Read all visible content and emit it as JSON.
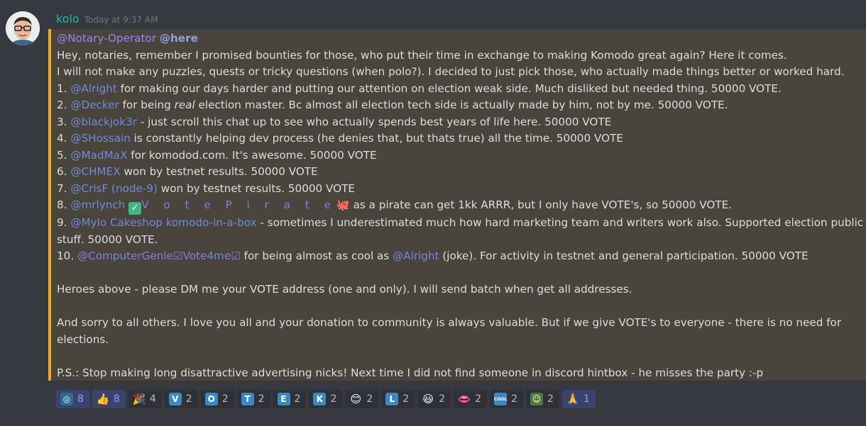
{
  "author": {
    "name": "kolo",
    "timestamp": "Today at 9:37 AM"
  },
  "message": {
    "mention_role": "@Notary-Operator",
    "mention_here": "@here",
    "line2": "Hey, notaries, remember I promised bounties for those, who put their time in exchange to making Komodo great again? Here it comes.",
    "line3": "I will not make any puzzles, quests or tricky questions (when polo?). I decided to just pick those, who actually made things better or worked hard.",
    "items": [
      {
        "num": "1.",
        "user": "@Alright",
        "text": " for making our days harder and putting our attention on election weak side. Much disliked but needed thing. 50000 VOTE."
      },
      {
        "num": "2.",
        "user": "@Decker",
        "pre": " for being ",
        "em": "real",
        "text": " election master. Bc almost all election tech side is actually made by him, not by me. 50000 VOTE."
      },
      {
        "num": "3.",
        "user": "@blackjok3r",
        "text": " - just scroll this chat up to see who actually spends best years of life here. 50000 VOTE"
      },
      {
        "num": "4.",
        "user": "@SHossain",
        "text": " is constantly helping dev process (he denies that, but thats true) all the time. 50000 VOTE"
      },
      {
        "num": "5.",
        "user": "@MadMaX",
        "text": " for komodod.com. It's awesome. 50000 VOTE"
      },
      {
        "num": "6.",
        "user": "@CHMEX",
        "text": " won by testnet results. 50000 VOTE"
      },
      {
        "num": "7.",
        "user": "@CrisF (node-9)",
        "text": " won by testnet results. 50000 VOTE"
      }
    ],
    "item8": {
      "num": "8.",
      "user": "@mrlynch",
      "check": "✓",
      "pirate": "V o t e P i r a t e",
      "octo": "🐙",
      "text": " as a pirate can get 1kk ARRR, but I only have VOTE's, so 50000 VOTE."
    },
    "item9": {
      "num": "9.",
      "user": "@Mylo Cakeshop komodo-in-a-box",
      "text": " - sometimes I underestimated much how hard marketing team and writers work also. Supported election public stuff. 50000 VOTE."
    },
    "item10": {
      "num": "10.",
      "user": "@ComputerGenie☑Vote4me☑",
      "mid": " for being almost as cool as ",
      "user2": "@Alright",
      "text": " (joke). For activity in testnet and general participation. 50000 VOTE"
    },
    "heroes": "Heroes above - please DM me your VOTE address (one and only). I will send batch when get all addresses.",
    "sorry": "And sorry to all others. I love you all and your donation to community is always valuable. But if we give VOTE's to everyone - there is no need for elections.",
    "ps": "P.S.: Stop making long disattractive advertising nicks! Next time I did not find someone in discord hintbox - he misses the party :-p"
  },
  "reactions": [
    {
      "icon": "komodo-icon",
      "glyph": "◎",
      "count": "8",
      "me": true,
      "color": "#2d6e8a"
    },
    {
      "icon": "thumbs-up-icon",
      "glyph": "👍",
      "count": "8",
      "me": true,
      "color": "transparent"
    },
    {
      "icon": "party-popper-icon",
      "glyph": "🎉",
      "count": "4",
      "me": false,
      "color": "transparent"
    },
    {
      "icon": "letter-v-icon",
      "glyph": "V",
      "count": "2",
      "me": false,
      "color": "#3b88c3"
    },
    {
      "icon": "letter-o-icon",
      "glyph": "O",
      "count": "2",
      "me": false,
      "color": "#3b88c3"
    },
    {
      "icon": "letter-t-icon",
      "glyph": "T",
      "count": "2",
      "me": false,
      "color": "#3b88c3"
    },
    {
      "icon": "letter-e-icon",
      "glyph": "E",
      "count": "2",
      "me": false,
      "color": "#3b88c3"
    },
    {
      "icon": "letter-k-icon",
      "glyph": "K",
      "count": "2",
      "me": false,
      "color": "#3b88c3"
    },
    {
      "icon": "smile-icon",
      "glyph": "😊",
      "count": "2",
      "me": false,
      "color": "transparent"
    },
    {
      "icon": "letter-l-icon",
      "glyph": "L",
      "count": "2",
      "me": false,
      "color": "#3b88c3"
    },
    {
      "icon": "grin-icon",
      "glyph": "😃",
      "count": "2",
      "me": false,
      "color": "transparent"
    },
    {
      "icon": "lips-icon",
      "glyph": "👄",
      "count": "2",
      "me": false,
      "color": "transparent"
    },
    {
      "icon": "cool-icon",
      "glyph": "COOL",
      "count": "2",
      "me": false,
      "color": "#3b88c3"
    },
    {
      "icon": "avatar-emoji-icon",
      "glyph": "☺",
      "count": "2",
      "me": false,
      "color": "#4a7a3a"
    },
    {
      "icon": "pray-icon",
      "glyph": "🙏",
      "count": "1",
      "me": true,
      "color": "transparent"
    }
  ]
}
